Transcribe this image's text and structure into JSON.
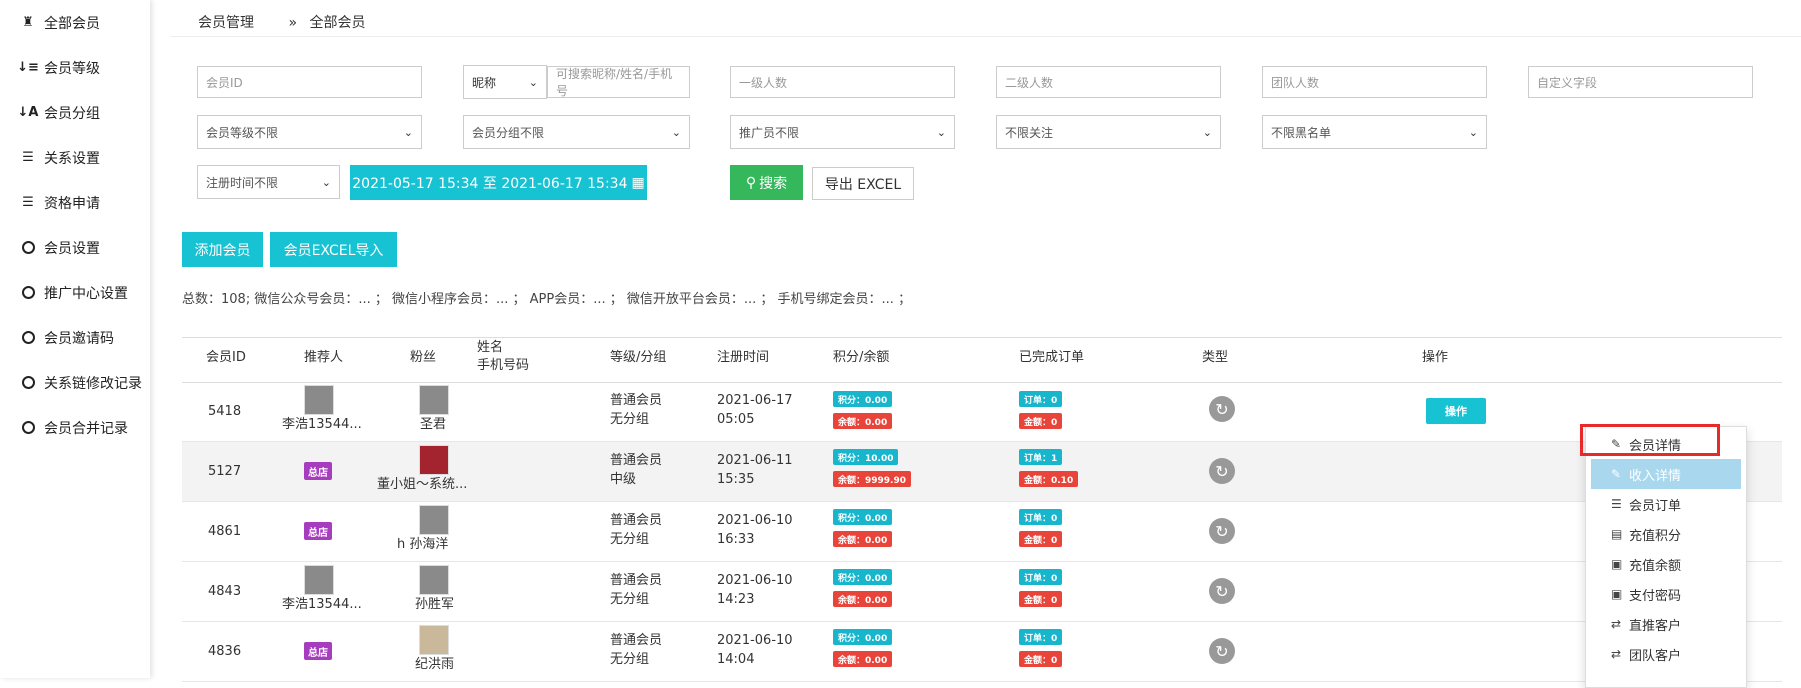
{
  "sidebar": {
    "items": [
      {
        "label": "全部会员",
        "icon": "users-icon"
      },
      {
        "label": "会员等级",
        "icon": "sort-numeric-icon"
      },
      {
        "label": "会员分组",
        "icon": "sort-alpha-icon"
      },
      {
        "label": "关系设置",
        "icon": "sliders-icon"
      },
      {
        "label": "资格申请",
        "icon": "sliders-icon"
      },
      {
        "label": "会员设置",
        "icon": "circle-icon"
      },
      {
        "label": "推广中心设置",
        "icon": "circle-icon"
      },
      {
        "label": "会员邀请码",
        "icon": "circle-icon"
      },
      {
        "label": "关系链修改记录",
        "icon": "circle-icon"
      },
      {
        "label": "会员合并记录",
        "icon": "circle-icon"
      }
    ]
  },
  "breadcrumb": {
    "parent": "会员管理",
    "sep": "»",
    "current": "全部会员"
  },
  "filters": {
    "member_id_placeholder": "会员ID",
    "nickname_select": "昵称",
    "nickname_placeholder": "可搜索昵称/姓名/手机号",
    "level1_placeholder": "一级人数",
    "level2_placeholder": "二级人数",
    "team_placeholder": "团队人数",
    "custom_placeholder": "自定义字段",
    "level_select": "会员等级不限",
    "group_select": "会员分组不限",
    "promoter_select": "推广员不限",
    "follow_select": "不限关注",
    "blacklist_select": "不限黑名单",
    "regtime_select": "注册时间不限",
    "daterange": "2021-05-17 15:34 至 2021-06-17 15:34",
    "search_btn": "搜索",
    "export_btn": "导出 EXCEL"
  },
  "actions": {
    "add": "添加会员",
    "import": "会员EXCEL导入"
  },
  "summary": "总数：108; 微信公众号会员：... ；  微信小程序会员：... ；  APP会员：... ；  微信开放平台会员：... ；  手机号绑定会员：... ；",
  "table": {
    "headers": {
      "id": "会员ID",
      "referrer": "推荐人",
      "fan": "粉丝",
      "name": "姓名",
      "phone": "手机号码",
      "level": "等级/分组",
      "regtime": "注册时间",
      "points": "积分/余额",
      "orders": "已完成订单",
      "type": "类型",
      "op": "操作"
    },
    "rows": [
      {
        "id": "5418",
        "referrer": "李浩13544...",
        "referrer_is_shop": false,
        "fan": "圣君",
        "level": "普通会员",
        "group": "无分组",
        "date": "2021-06-17",
        "time": "05:05",
        "points": "积分：0.00",
        "balance": "余额：0.00",
        "orders": "订单：0",
        "amount": "金额：0"
      },
      {
        "id": "5127",
        "referrer": "",
        "referrer_is_shop": true,
        "fan": "董小姐～系统...",
        "level": "普通会员",
        "group": "中级",
        "date": "2021-06-11",
        "time": "15:35",
        "points": "积分：10.00",
        "balance": "余额：9999.90",
        "orders": "订单：1",
        "amount": "金额：0.10"
      },
      {
        "id": "4861",
        "referrer": "",
        "referrer_is_shop": true,
        "fan": "h 孙海洋",
        "level": "普通会员",
        "group": "无分组",
        "date": "2021-06-10",
        "time": "16:33",
        "points": "积分：0.00",
        "balance": "余额：0.00",
        "orders": "订单：0",
        "amount": "金额：0"
      },
      {
        "id": "4843",
        "referrer": "李浩13544...",
        "referrer_is_shop": false,
        "fan": "孙胜军",
        "level": "普通会员",
        "group": "无分组",
        "date": "2021-06-10",
        "time": "14:23",
        "points": "积分：0.00",
        "balance": "余额：0.00",
        "orders": "订单：0",
        "amount": "金额：0"
      },
      {
        "id": "4836",
        "referrer": "",
        "referrer_is_shop": true,
        "fan": "纪洪雨",
        "level": "普通会员",
        "group": "无分组",
        "date": "2021-06-10",
        "time": "14:04",
        "points": "积分：0.00",
        "balance": "余额：0.00",
        "orders": "订单：0",
        "amount": "金额：0"
      }
    ],
    "shop_badge": "总店",
    "op_button": "操作"
  },
  "dropdown": [
    {
      "label": "会员详情",
      "icon": "edit-icon"
    },
    {
      "label": "收入详情",
      "icon": "edit-icon"
    },
    {
      "label": "会员订单",
      "icon": "list-icon"
    },
    {
      "label": "充值积分",
      "icon": "credit-card-icon"
    },
    {
      "label": "充值余额",
      "icon": "money-icon"
    },
    {
      "label": "支付密码",
      "icon": "money-icon"
    },
    {
      "label": "直推客户",
      "icon": "exchange-icon"
    },
    {
      "label": "团队客户",
      "icon": "exchange-icon"
    }
  ]
}
